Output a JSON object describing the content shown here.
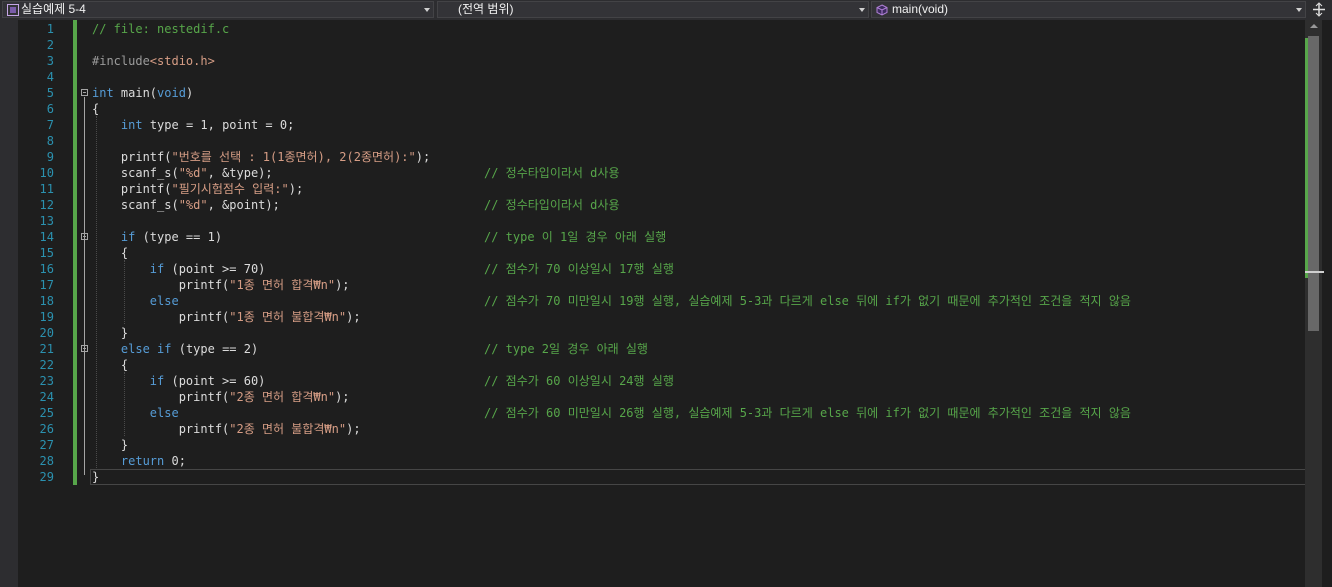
{
  "navbar": {
    "project": "실습예제 5-4",
    "scope": "(전역 범위)",
    "member": "main(void)"
  },
  "colors": {
    "keyword": "#569cd6",
    "string": "#d69d85",
    "comment": "#57a64a",
    "line_number": "#2b91af"
  },
  "editor": {
    "line_numbers": [
      "1",
      "2",
      "3",
      "4",
      "5",
      "6",
      "7",
      "8",
      "9",
      "10",
      "11",
      "12",
      "13",
      "14",
      "15",
      "16",
      "17",
      "18",
      "19",
      "20",
      "21",
      "22",
      "23",
      "24",
      "25",
      "26",
      "27",
      "28",
      "29"
    ],
    "lines": [
      "// file: nestedif.c",
      "",
      "#include<stdio.h>",
      "",
      "int main(void)",
      "{",
      "    int type = 1, point = 0;",
      "",
      "    printf(\"번호를 선택 : 1(1종면허), 2(2종면허):\");",
      "    scanf_s(\"%d\", &type);",
      "    printf(\"필기시험점수 입력:\");",
      "    scanf_s(\"%d\", &point);",
      "",
      "    if (type == 1)",
      "    {",
      "        if (point >= 70)",
      "            printf(\"1종 면허 합격₩n\");",
      "        else",
      "            printf(\"1종 면허 불합격₩n\");",
      "    }",
      "    else if (type == 2)",
      "    {",
      "        if (point >= 60)",
      "            printf(\"2종 면허 합격₩n\");",
      "        else",
      "            printf(\"2종 면허 불합격₩n\");",
      "    }",
      "    return 0;",
      "}"
    ],
    "comments": {
      "10": "// 정수타입이라서 d사용",
      "12": "// 정수타입이라서 d사용",
      "14": "// type 이 1일 경우 아래 실행",
      "16": "// 점수가 70 이상일시 17행 실행",
      "18": "// 점수가 70 미만일시 19행 실행, 실습예제 5-3과 다르게 else 뒤에 if가 없기 때문에 추가적인 조건을 적지 않음",
      "21": "// type 2일 경우 아래 실행",
      "23": "// 점수가 60 이상일시 24행 실행",
      "25": "// 점수가 60 미만일시 26행 실행, 실습예제 5-3과 다르게 else 뒤에 if가 없기 때문에 추가적인 조건을 적지 않음"
    }
  }
}
